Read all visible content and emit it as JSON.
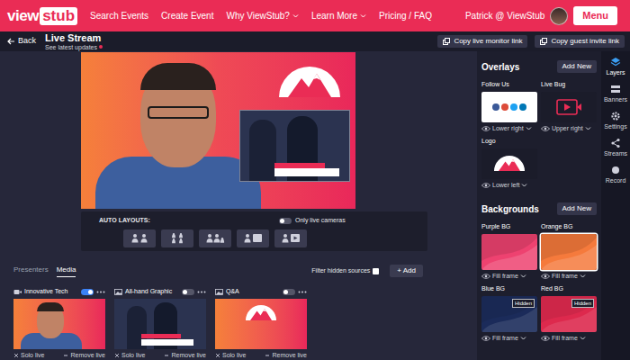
{
  "nav": {
    "logo": {
      "left": "view",
      "right": "stub"
    },
    "links": [
      {
        "label": "Search Events",
        "dropdown": false
      },
      {
        "label": "Create Event",
        "dropdown": false
      },
      {
        "label": "Why ViewStub?",
        "dropdown": true
      },
      {
        "label": "Learn More",
        "dropdown": true
      },
      {
        "label": "Pricing / FAQ",
        "dropdown": false
      }
    ],
    "user": "Patrick @ ViewStub",
    "menu_button": "Menu"
  },
  "header": {
    "back": "Back",
    "title": "Live Stream",
    "subtitle": "See latest updates",
    "buttons": [
      "Copy live monitor link",
      "Copy guest invite link"
    ]
  },
  "auto_layouts": {
    "label": "AUTO LAYOUTS:",
    "only_live_cameras": {
      "label": "Only live cameras",
      "on": false
    },
    "layouts": [
      {
        "kind": "pair",
        "selected": false
      },
      {
        "kind": "grid",
        "selected": false
      },
      {
        "kind": "trio",
        "selected": false
      },
      {
        "kind": "screen",
        "selected": false
      },
      {
        "kind": "media",
        "selected": false
      }
    ]
  },
  "source_tabs": [
    {
      "label": "Presenters",
      "selected": false
    },
    {
      "label": "Media",
      "selected": true
    }
  ],
  "filter_hidden_sources": {
    "label": "Filter hidden sources",
    "checked": false
  },
  "add_button": "+ Add",
  "media": [
    {
      "title": "Innovative Tech",
      "kind": "camera",
      "live": true,
      "actions": [
        "Solo live",
        "Remove live"
      ]
    },
    {
      "title": "All-hand Graphic",
      "kind": "graphic",
      "live": false,
      "actions": [
        "Solo live",
        "Remove live"
      ]
    },
    {
      "title": "Q&A",
      "kind": "qa",
      "live": false,
      "actions": [
        "Solo live",
        "Remove live"
      ]
    }
  ],
  "overlays": {
    "title": "Overlays",
    "add_button": "Add New",
    "items": [
      {
        "name": "Follow Us",
        "kind": "social",
        "visible": true,
        "position": "Lower right"
      },
      {
        "name": "Live Bug",
        "kind": "livebug",
        "visible": true,
        "position": "Upper right"
      },
      {
        "name": "Logo",
        "kind": "logo",
        "visible": true,
        "position": "Lower left"
      }
    ]
  },
  "backgrounds": {
    "title": "Backgrounds",
    "add_button": "Add New",
    "items": [
      {
        "name": "Purple BG",
        "fit": "Fill frame",
        "selected": false,
        "hidden": false,
        "color": "#ee4270"
      },
      {
        "name": "Orange BG",
        "fit": "Fill frame",
        "selected": true,
        "hidden": false,
        "color": "#f57a3c"
      },
      {
        "name": "Blue BG",
        "fit": "Fill frame",
        "selected": false,
        "hidden": true,
        "badge": "Hidden",
        "color": "#1c2c5a"
      },
      {
        "name": "Red BG",
        "fit": "Fill frame",
        "selected": false,
        "hidden": true,
        "badge": "Hidden",
        "color": "#dd2a4e"
      }
    ]
  },
  "tools": [
    {
      "label": "Layers",
      "kind": "layers",
      "selected": true
    },
    {
      "label": "Banners",
      "kind": "banners",
      "selected": false
    },
    {
      "label": "Settings",
      "kind": "settings",
      "selected": false
    },
    {
      "label": "Streams",
      "kind": "streams",
      "selected": false
    },
    {
      "label": "Record",
      "kind": "record",
      "selected": false
    }
  ]
}
